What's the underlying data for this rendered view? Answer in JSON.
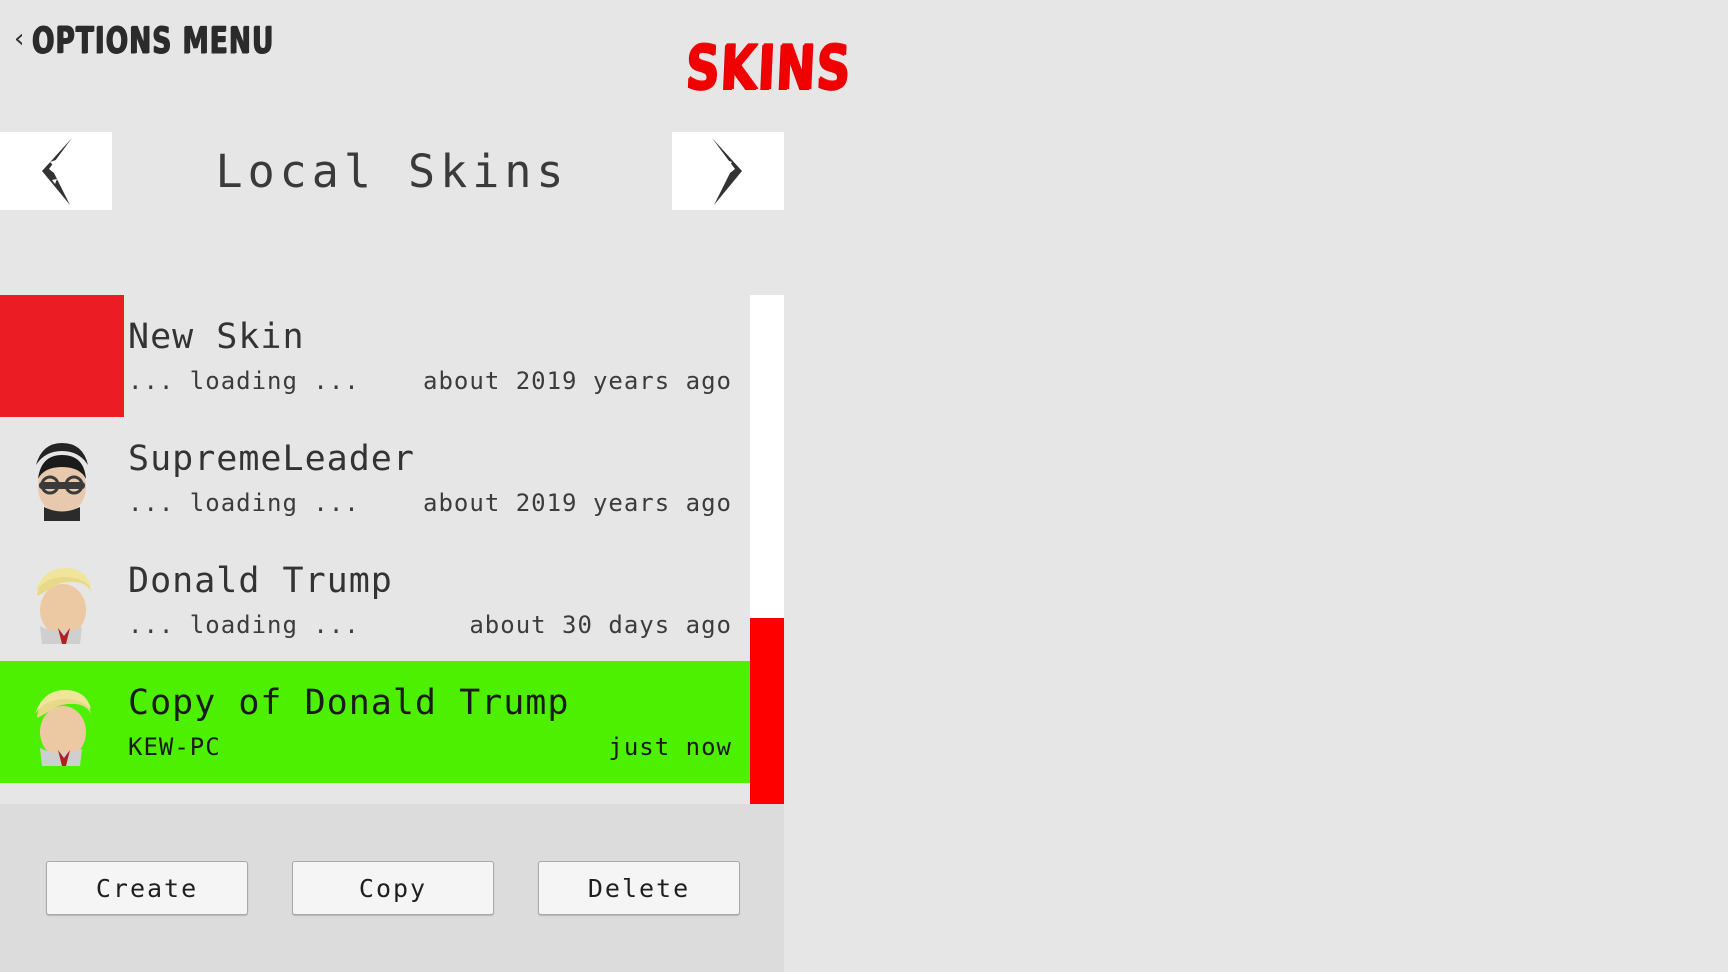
{
  "header": {
    "back_chevron": "chevron-left-icon",
    "back_label": "OPTIONS MENU",
    "logo": "SKINS",
    "logo_color": "#f00000"
  },
  "nav": {
    "prev_icon": "chevron-left-icon",
    "next_icon": "chevron-right-icon",
    "title": "Local Skins"
  },
  "list": {
    "rows": [
      {
        "name": "New Skin",
        "status": "... loading ...",
        "time": "about 2019 years ago",
        "thumb": "red-block-thumbnail",
        "selected": false
      },
      {
        "name": "SupremeLeader",
        "status": "... loading ...",
        "time": "about 2019 years ago",
        "thumb": "supreme-leader-head-thumbnail",
        "selected": false
      },
      {
        "name": "Donald Trump",
        "status": "... loading ...",
        "time": "about 30 days ago",
        "thumb": "donald-trump-head-thumbnail",
        "selected": false
      },
      {
        "name": "Copy of Donald Trump",
        "status": "KEW-PC",
        "time": "just now",
        "thumb": "donald-trump-head-thumbnail",
        "selected": true
      }
    ],
    "selected_color": "#4df000",
    "scrollbar_track_color": "#ffffff",
    "scrollbar_thumb_color": "#ff0000"
  },
  "actions": {
    "create_label": "Create",
    "copy_label": "Copy",
    "delete_label": "Delete"
  }
}
